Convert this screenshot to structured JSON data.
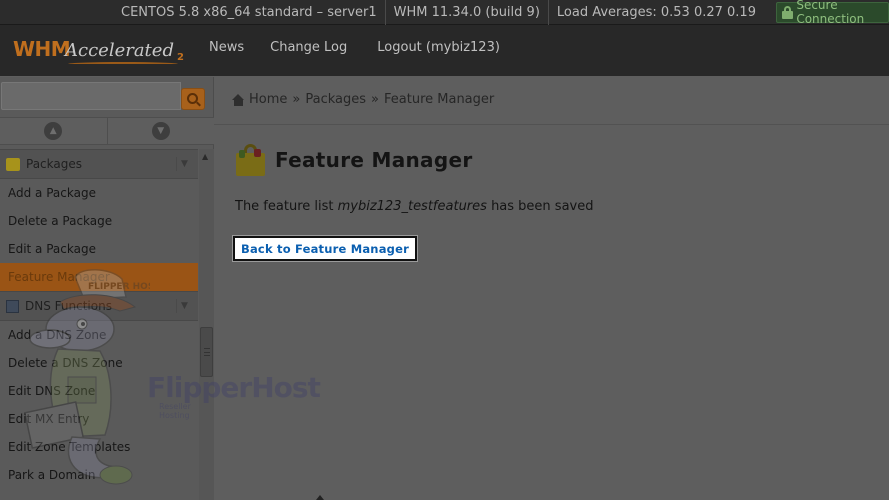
{
  "topbar": {
    "os": "CENTOS 5.8 x86_64 standard – server1",
    "version": "WHM 11.34.0 (build 9)",
    "load": "Load Averages: 0.53 0.27 0.19",
    "secure": "Secure Connection"
  },
  "header": {
    "logo_main": "WHM",
    "logo_accent": "Accelerated",
    "logo_version": "2",
    "nav": [
      "News",
      "Change Log",
      "Logout (mybiz123)"
    ]
  },
  "sidebar": {
    "search_placeholder": "",
    "categories": [
      {
        "label": "Packages",
        "icon": "package-icon"
      },
      {
        "label": "DNS Functions",
        "icon": "dns-icon"
      }
    ],
    "packages_items": [
      "Add a Package",
      "Delete a Package",
      "Edit a Package",
      "Feature Manager"
    ],
    "dns_items": [
      "Add a DNS Zone",
      "Delete a DNS Zone",
      "Edit DNS Zone",
      "Edit MX Entry",
      "Edit Zone Templates",
      "Park a Domain"
    ],
    "active_item": "Feature Manager",
    "watermark": {
      "brand": "FlipperHost",
      "cap_text": "FLIPPER HOST",
      "sub": "Reseller Hosting"
    }
  },
  "breadcrumb": [
    "Home",
    "Packages",
    "Feature Manager"
  ],
  "main": {
    "title": "Feature Manager",
    "message_prefix": "The feature list ",
    "feature_list_name": "mybiz123_testfeatures",
    "message_suffix": " has been saved",
    "back_button": "Back to Feature Manager"
  },
  "colors": {
    "accent_orange": "#c06f1e",
    "link_blue": "#0b5fb0",
    "secure_green": "#8fbf7f"
  }
}
